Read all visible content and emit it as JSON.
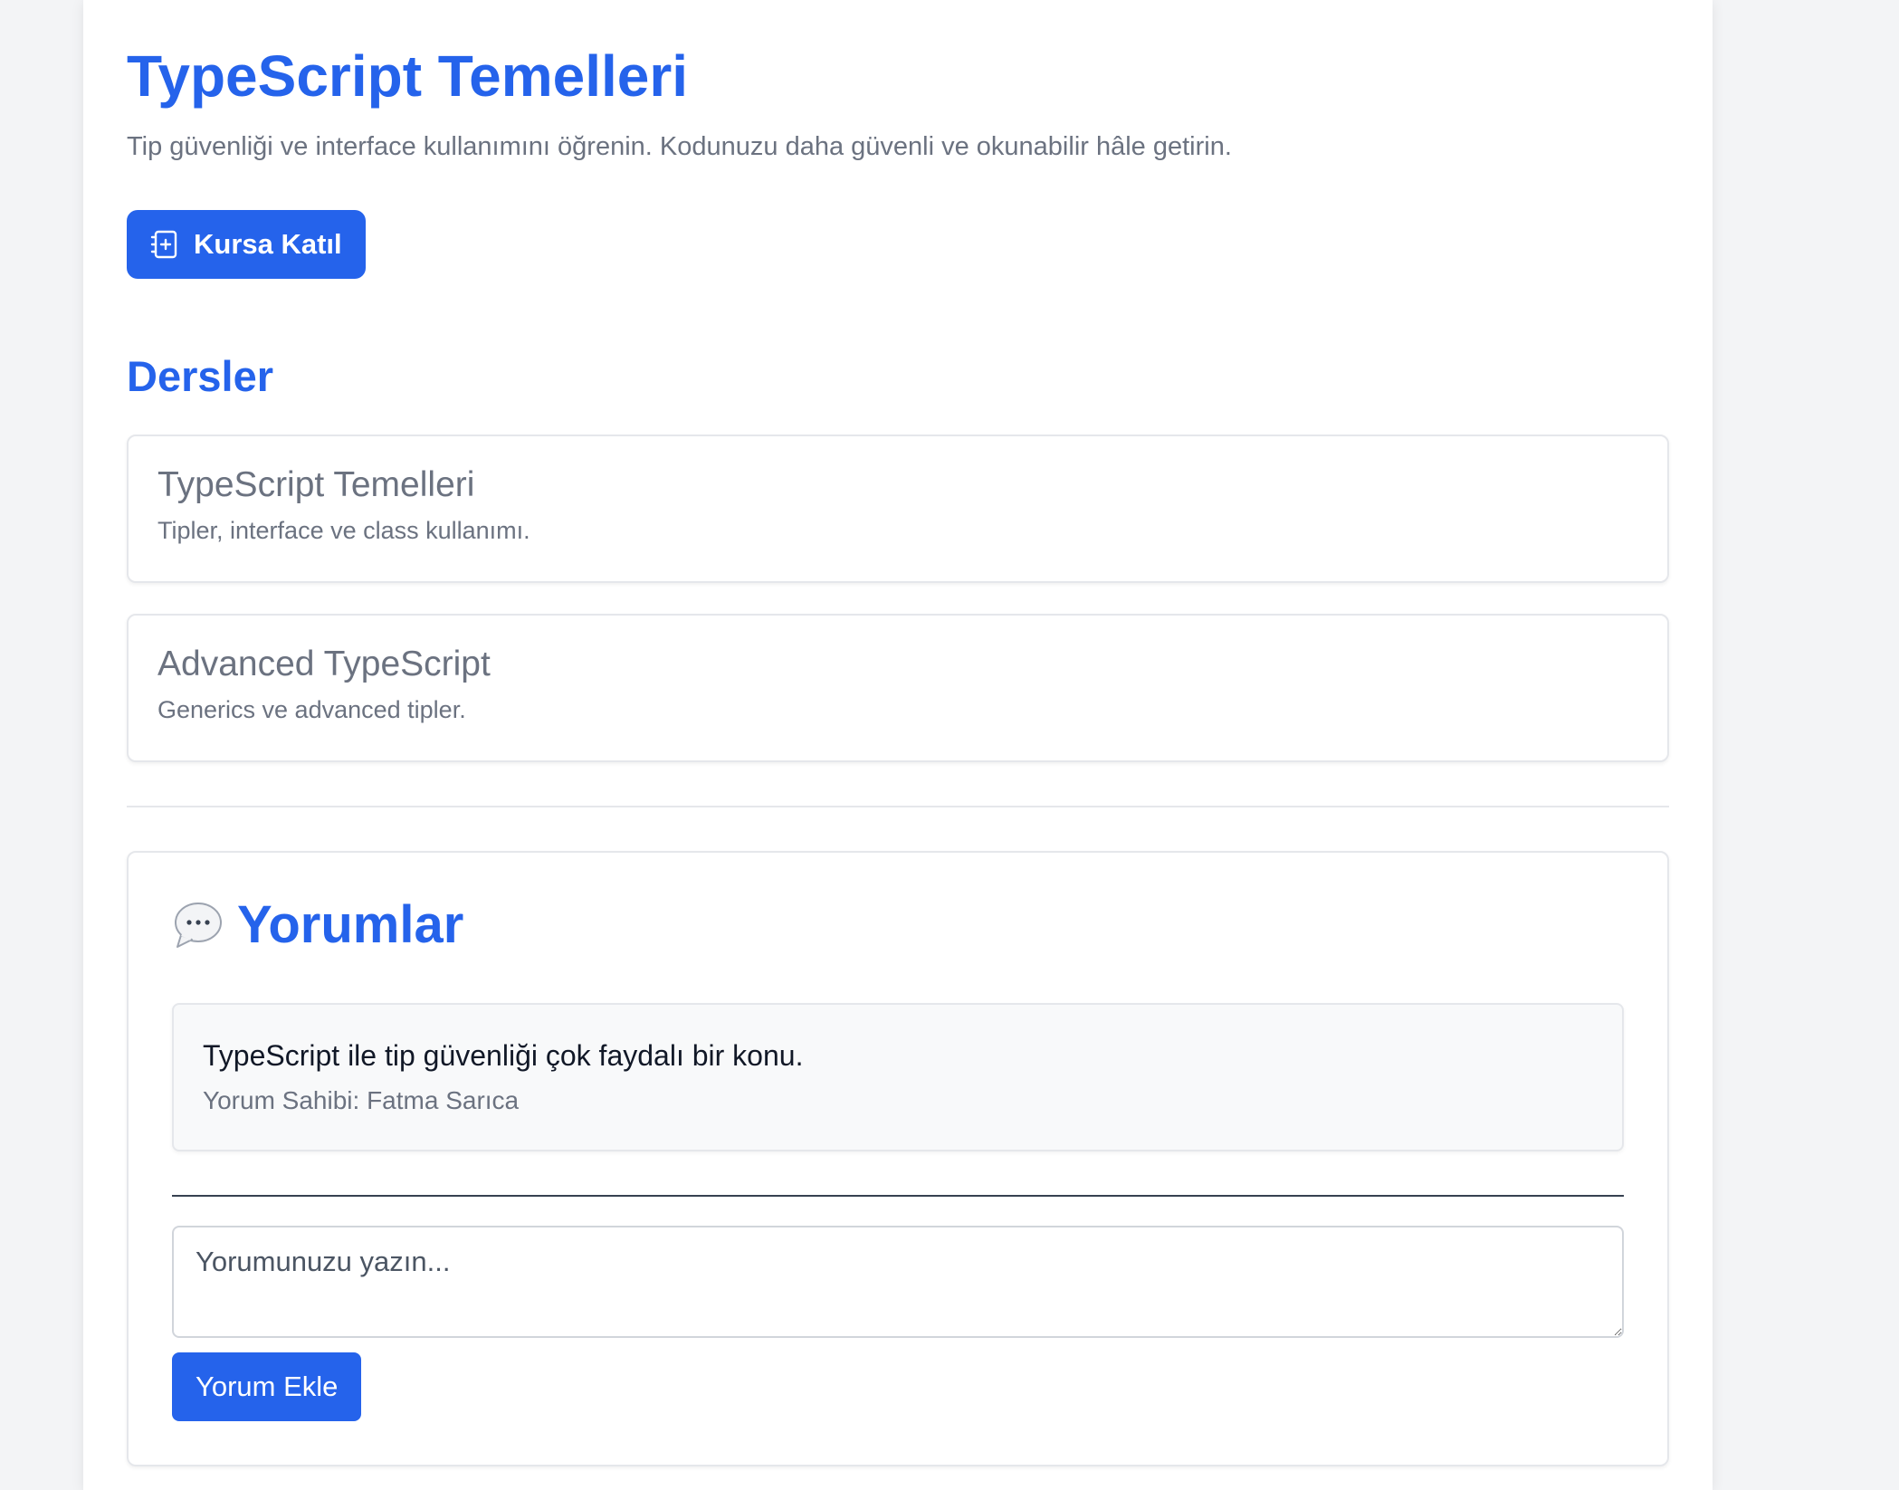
{
  "course": {
    "title": "TypeScript Temelleri",
    "description": "Tip güvenliği ve interface kullanımını öğrenin. Kodunuzu daha güvenli ve okunabilir hâle getirin.",
    "join_button_label": "Kursa Katıl",
    "join_button_icon": "add-notebook-icon"
  },
  "lessons": {
    "section_title": "Dersler",
    "items": [
      {
        "title": "TypeScript Temelleri",
        "description": "Tipler, interface ve class kullanımı."
      },
      {
        "title": "Advanced TypeScript",
        "description": "Generics ve advanced tipler."
      }
    ]
  },
  "comments": {
    "section_title": "Yorumlar",
    "section_icon": "speech-bubble-icon",
    "items": [
      {
        "text": "TypeScript ile tip güvenliği çok faydalı bir konu.",
        "author_line": "Yorum Sahibi: Fatma Sarıca"
      }
    ],
    "input_placeholder": "Yorumunuzu yazın...",
    "input_value": "",
    "add_button_label": "Yorum Ekle"
  },
  "colors": {
    "accent": "#2563eb",
    "muted_text": "#6b7280",
    "page_background": "#f3f4f6"
  }
}
